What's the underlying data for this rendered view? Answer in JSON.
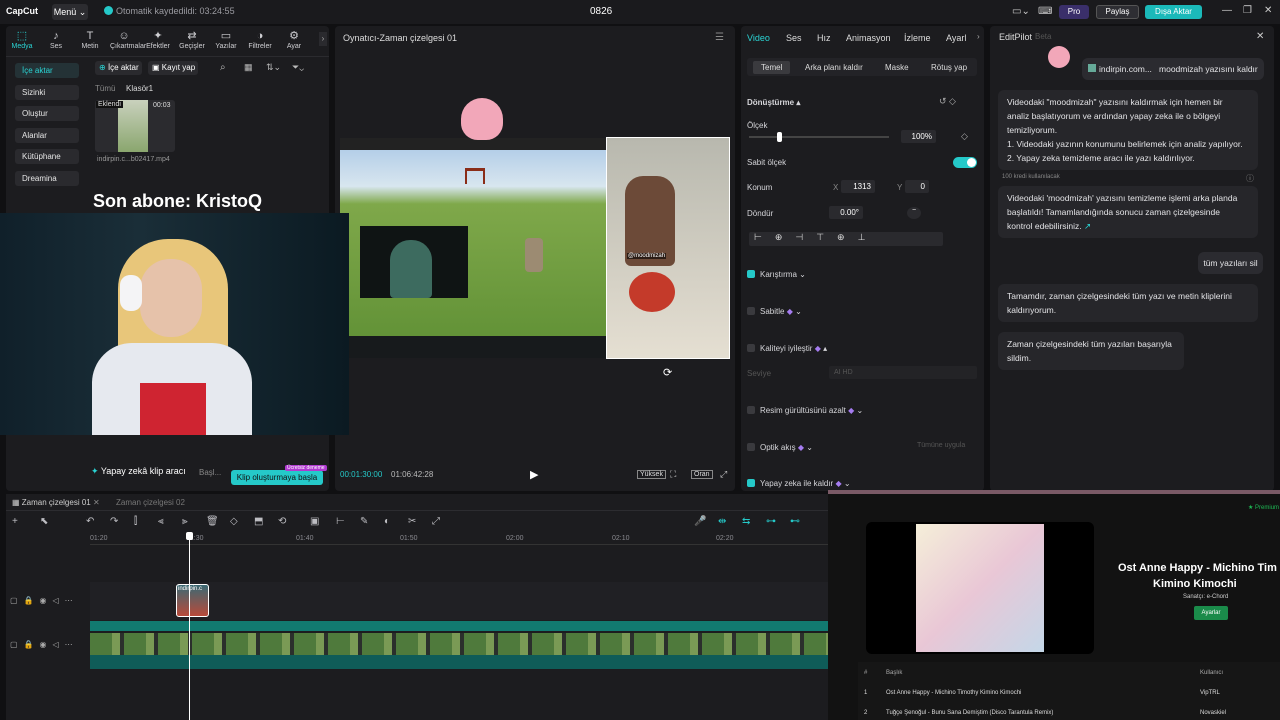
{
  "app": {
    "logo": "CapCut",
    "menu": "Menü",
    "autosave": "Otomatik kaydedildi: 03:24:55",
    "project": "0826",
    "pro": "Pro",
    "share": "Paylaş",
    "export": "Dışa Aktar"
  },
  "media": {
    "tabs": [
      {
        "label": "Medya",
        "icon": "⬚"
      },
      {
        "label": "Ses",
        "icon": "♪"
      },
      {
        "label": "Metin",
        "icon": "T"
      },
      {
        "label": "Çıkartmalar",
        "icon": "☺"
      },
      {
        "label": "Efektler",
        "icon": "✦"
      },
      {
        "label": "Geçişler",
        "icon": "⇄"
      },
      {
        "label": "Yazılar",
        "icon": "▭"
      },
      {
        "label": "Filtreler",
        "icon": "◑"
      },
      {
        "label": "Ayar",
        "icon": "⚙"
      }
    ],
    "sidebar": [
      "İçe aktar",
      "Sizinki",
      "Oluştur",
      "Alanlar",
      "Kütüphane",
      "Dreamina"
    ],
    "import_btn": "İçe aktar",
    "record_btn": "Kayıt yap",
    "filters": [
      "Tümü",
      "Klasör1"
    ],
    "clip": {
      "badge": "Eklendi",
      "duration": "00:03",
      "name": "indirpin.c...b02417.mp4"
    },
    "ai_tool": "Yapay zekâ klip aracı",
    "ai_start": "Başl...",
    "clip_create": "Klip oluşturmaya başla",
    "clip_tag": "Ücretsiz deneme"
  },
  "overlay": {
    "subscriber": "Son abone: KristoQ"
  },
  "player": {
    "title": "Oynatıcı-Zaman çizelgesi 01",
    "current": "00:01:30:00",
    "total": "01:06:42:28",
    "quality": "Yüksek",
    "ratio": "Oran",
    "game_caption": "@moodmizah"
  },
  "props": {
    "tabs": [
      "Video",
      "Ses",
      "Hız",
      "Animasyon",
      "İzleme",
      "Ayarl"
    ],
    "subtabs": [
      "Temel",
      "Arka planı kaldır",
      "Maske",
      "Rötuş yap"
    ],
    "transform": "Dönüştürme",
    "scale_label": "Ölçek",
    "scale_val": "100%",
    "fixed_scale": "Sabit ölçek",
    "position": "Konum",
    "pos_x_label": "X",
    "pos_x": "1313",
    "pos_y_label": "Y",
    "pos_y": "0",
    "rotate": "Döndür",
    "rotate_val": "0.00°",
    "blend": "Karıştırma",
    "stabilize": "Sabitle",
    "enhance": "Kaliteyi iyileştir",
    "level": "Seviye",
    "level_val": "AI HD",
    "denoise": "Resim gürültüsünü azalt",
    "optical": "Optik akış",
    "apply_all": "Tümüne uygula",
    "ai_remove": "Yapay zeka ile kaldır"
  },
  "pilot": {
    "title": "EditPilot",
    "beta": "Beta",
    "user1_file": "indirpin.com...",
    "user1_text": "moodmizah yazısını kaldır",
    "bot1": [
      "Videodaki \"moodmizah\" yazısını kaldırmak için hemen bir",
      "analiz başlatıyorum ve ardından yapay zeka ile o bölgeyi",
      "temizliyorum.",
      "1. Videodaki yazının konumunu belirlemek için analiz yapılıyor.",
      "2. Yapay zeka temizleme aracı ile yazı kaldırılıyor."
    ],
    "credits": "100 kredi kullanılacak",
    "bot2": [
      "Videodaki 'moodmizah' yazısını temizleme işlemi arka planda",
      "başlatıldı! Tamamlandığında sonucu zaman çizelgesinde",
      "kontrol edebilirsiniz."
    ],
    "user2": "tüm yazıları sil",
    "bot3": [
      "Tamamdır, zaman çizelgesindeki tüm yazı ve metin kliplerini",
      "kaldırıyorum."
    ],
    "bot4": "Zaman çizelgesindeki tüm yazıları başarıyla sildim."
  },
  "timeline": {
    "tabs": [
      "Zaman çizelgesi 01",
      "Zaman çizelgesi 02"
    ],
    "ruler": [
      "01:20",
      "01:30",
      "01:40",
      "01:50",
      "02:00",
      "02:10",
      "02:20"
    ],
    "clip_label": "indirpin.c"
  },
  "spotify": {
    "premium": "Premium",
    "song": "Ost Anne Happy - Michino Tim",
    "song2": "Kimino Kimochi",
    "artist": "Sanatçı: e-Chord",
    "follow": "Ayarlar",
    "cols": [
      "#",
      "Başlık",
      "Kullanıcı"
    ],
    "rows": [
      {
        "n": "1",
        "title": "Ost Anne Happy - Michino Timothy Kimino Kimochi",
        "user": "VipTRL"
      },
      {
        "n": "2",
        "title": "Tuğçe Şenoğul - Bunu Sana Demiştim (Disco Tarantula Remix)",
        "user": "Novaskiel"
      }
    ]
  }
}
